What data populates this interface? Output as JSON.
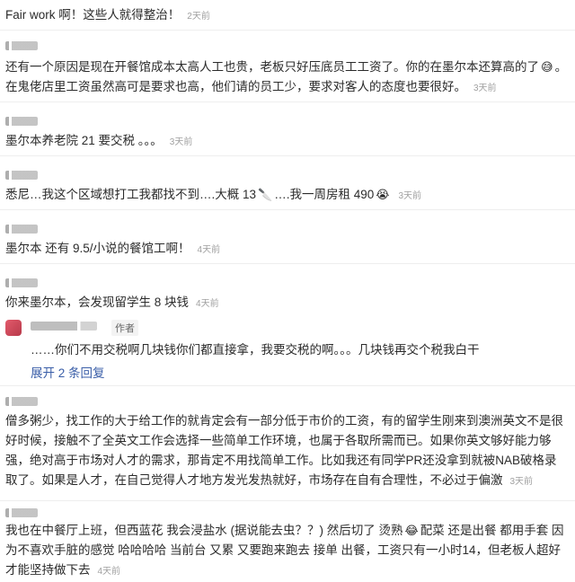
{
  "comments": [
    {
      "text": "Fair work 啊！这些人就得整治！",
      "time": "2天前"
    },
    {
      "text": "还有一个原因是现在开餐馆成本太高人工也贵，老板只好压底员工工资了。你的在墨尔本还算高的了",
      "emoji_a": "😅",
      "text_b": "。在鬼佬店里工资虽然高可是要求也高，他们请的员工少，要求对客人的态度也要很好。",
      "time": "3天前"
    },
    {
      "text": "墨尔本养老院 21 要交税 。。。",
      "time": "3天前"
    },
    {
      "text": "悉尼…我这个区域想打工我都找不到….大概 13",
      "emoji_a": "🔪",
      "text_b": "….我一周房租 490",
      "emoji_b": "😭",
      "time": "3天前"
    },
    {
      "text": "墨尔本 还有 9.5/小说的餐馆工啊！",
      "time": "4天前"
    },
    {
      "text": "你来墨尔本，会发现留学生 8 块钱",
      "time": "4天前",
      "reply": {
        "author_tag": "作者",
        "text": "……你们不用交税啊几块钱你们都直接拿，我要交税的啊。。。几块钱再交个税我白干",
        "expand_label": "展开 2 条回复"
      }
    },
    {
      "text": "僧多粥少，找工作的大于给工作的就肯定会有一部分低于市价的工资，有的留学生刚来到澳洲英文不是很好时候，接触不了全英文工作会选择一些简单工作环境，也属于各取所需而已。如果你英文够好能力够强，绝对高于市场对人才的需求，那肯定不用找简单工作。比如我还有同学PR还没拿到就被NAB破格录取了。如果是人才，在自己觉得人才地方发光发热就好，市场存在自有合理性，不必过于偏激",
      "time": "3天前"
    },
    {
      "text": "我也在中餐厅上班，但西蓝花 我会浸盐水 (据说能去虫？？) 然后切了 烫熟",
      "emoji_a": "😂",
      "text_b": "配菜 还是出餐 都用手套 因为不喜欢手脏的感觉 哈哈哈哈 当前台 又累 又要跑来跑去 接单 出餐，工资只有一小时14，但老板人超好 才能坚持做下去",
      "time": "4天前"
    }
  ]
}
